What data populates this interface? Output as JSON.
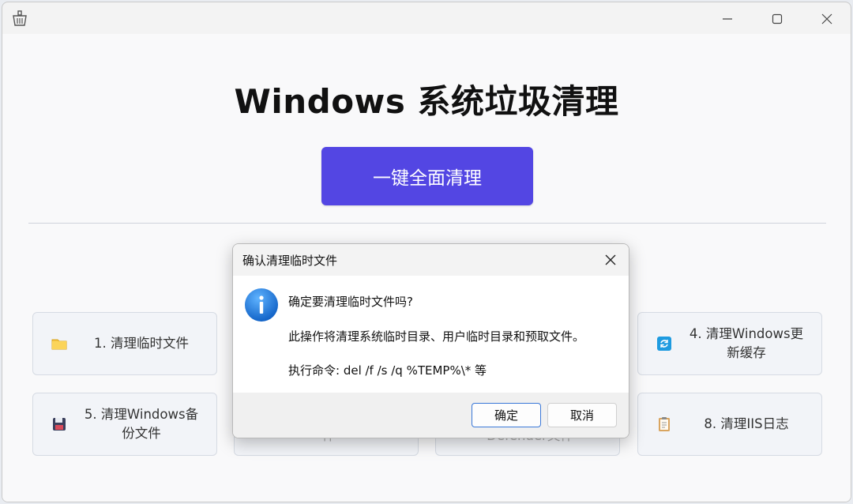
{
  "window": {
    "icon": "broom-basket-icon"
  },
  "main": {
    "title": "Windows 系统垃圾清理",
    "primary_button": "一键全面清理"
  },
  "cards": [
    {
      "label": "1. 清理临时文件",
      "icon": "folder-icon"
    },
    {
      "label": "4. 清理Windows更新缓存",
      "icon": "refresh-icon"
    },
    {
      "label": "5. 清理Windows备份文件",
      "icon": "floppy-disk-icon"
    },
    {
      "label": "件",
      "icon": ""
    },
    {
      "label": "Defender文件",
      "icon": ""
    },
    {
      "label": "8. 清理IIS日志",
      "icon": "clipboard-icon"
    }
  ],
  "dialog": {
    "title": "确认清理临时文件",
    "line1": "确定要清理临时文件吗?",
    "line2": "此操作将清理系统临时目录、用户临时目录和预取文件。",
    "line3": "执行命令: del /f /s /q %TEMP%\\* 等",
    "ok_label": "确定",
    "cancel_label": "取消"
  },
  "colors": {
    "accent": "#5346e3",
    "info": "#1a73d9"
  }
}
